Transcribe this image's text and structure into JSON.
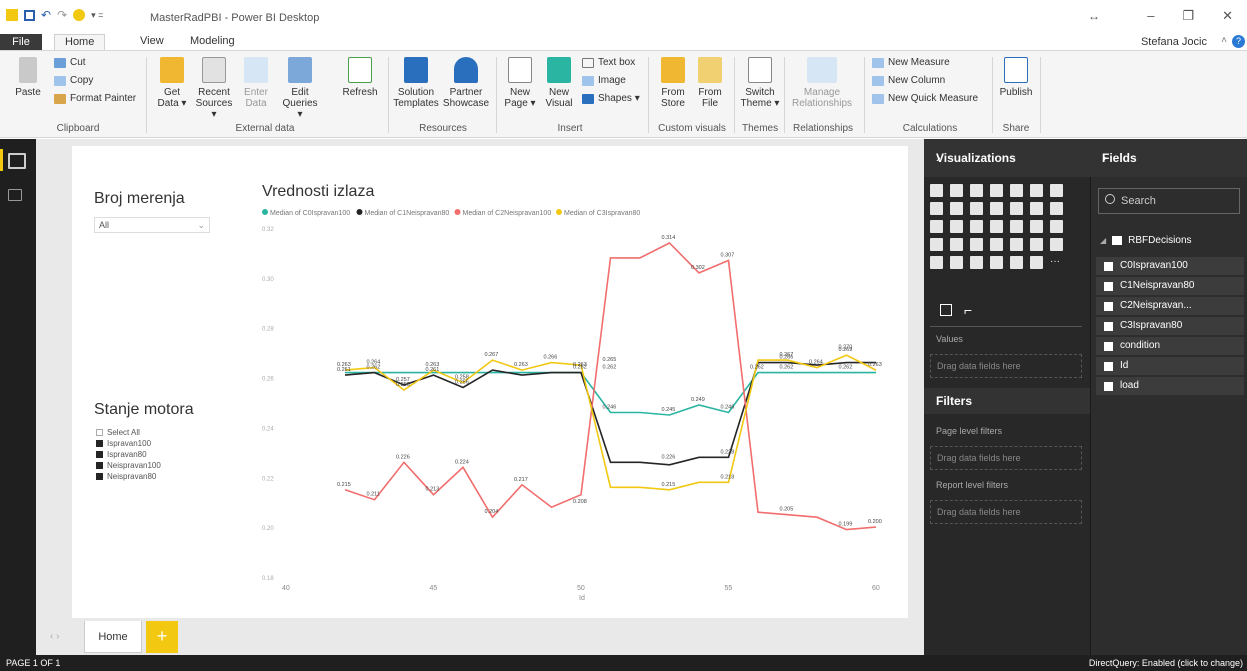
{
  "window": {
    "title": "MasterRadPBI - Power BI Desktop",
    "user": "Stefana Jocic"
  },
  "tabs": {
    "file": "File",
    "home": "Home",
    "view": "View",
    "modeling": "Modeling"
  },
  "ribbon": {
    "paste": "Paste",
    "cut": "Cut",
    "copy": "Copy",
    "format_painter": "Format Painter",
    "get_data": "Get Data ▾",
    "recent_sources": "Recent Sources ▾",
    "enter_data": "Enter Data",
    "edit_queries": "Edit Queries ▾",
    "refresh": "Refresh",
    "solution_templates": "Solution Templates",
    "partner_showcase": "Partner Showcase",
    "new_page": "New Page ▾",
    "new_visual": "New Visual",
    "text_box": "Text box",
    "image": "Image",
    "shapes": "Shapes ▾",
    "from_store": "From Store",
    "from_file": "From File",
    "switch_theme": "Switch Theme ▾",
    "manage_relationships": "Manage Relationships",
    "new_measure": "New Measure",
    "new_column": "New Column",
    "new_quick_measure": "New Quick Measure",
    "publish": "Publish",
    "groups": {
      "clipboard": "Clipboard",
      "external_data": "External data",
      "resources": "Resources",
      "insert": "Insert",
      "custom_visuals": "Custom visuals",
      "themes": "Themes",
      "relationships": "Relationships",
      "calculations": "Calculations",
      "share": "Share"
    }
  },
  "report": {
    "slicer1": {
      "title": "Broj merenja",
      "value": "All"
    },
    "slicer2": {
      "title": "Stanje motora",
      "items": [
        "Select All",
        "Ispravan100",
        "Ispravan80",
        "Neispravan100",
        "Neispravan80"
      ]
    }
  },
  "chart_data": {
    "type": "line",
    "title": "Vrednosti izlaza",
    "xlabel": "Id",
    "ylabel": "",
    "xlim": [
      40,
      60
    ],
    "ylim": [
      0.18,
      0.32
    ],
    "xticks": [
      40,
      45,
      50,
      55,
      60
    ],
    "yticks": [
      "0.18",
      "0.20",
      "0.22",
      "0.24",
      "0.26",
      "0.28",
      "0.30",
      "0.32"
    ],
    "x": [
      42,
      43,
      44,
      45,
      46,
      47,
      48,
      49,
      50,
      51,
      52,
      53,
      54,
      55,
      56,
      57,
      58,
      59,
      60
    ],
    "legend_position": "top-left",
    "series": [
      {
        "name": "Median of C0Ispravan100",
        "color": "#2ab4a2",
        "values": [
          0.262,
          0.262,
          0.262,
          0.262,
          0.262,
          0.262,
          0.262,
          0.262,
          0.262,
          0.246,
          0.246,
          0.245,
          0.249,
          0.246,
          0.262,
          0.262,
          0.262,
          0.262,
          0.262
        ]
      },
      {
        "name": "Median of C1Neispravan80",
        "color": "#252525",
        "values": [
          0.261,
          0.262,
          0.257,
          0.261,
          0.256,
          0.263,
          0.261,
          0.262,
          0.262,
          0.226,
          0.226,
          0.225,
          0.228,
          0.228,
          0.266,
          0.266,
          0.265,
          0.266,
          0.266
        ]
      },
      {
        "name": "Median of C2Neispravan100",
        "color": "#f26d6d",
        "values": [
          0.215,
          0.211,
          0.226,
          0.213,
          0.224,
          0.204,
          0.217,
          0.208,
          0.213,
          0.308,
          0.308,
          0.314,
          0.302,
          0.307,
          0.206,
          0.205,
          0.204,
          0.199,
          0.2
        ]
      },
      {
        "name": "Median of C3Ispravan80",
        "color": "#f2c811",
        "values": [
          0.263,
          0.264,
          0.255,
          0.263,
          0.258,
          0.267,
          0.263,
          0.266,
          0.265,
          0.216,
          0.216,
          0.215,
          0.218,
          0.218,
          0.267,
          0.267,
          0.264,
          0.269,
          0.263
        ]
      }
    ],
    "labels": [
      {
        "x": 42,
        "y": 0.263,
        "t": "0.263"
      },
      {
        "x": 43,
        "y": 0.264,
        "t": "0.264"
      },
      {
        "x": 42,
        "y": 0.261,
        "t": "0.261"
      },
      {
        "x": 43,
        "y": 0.262,
        "t": "0.262"
      },
      {
        "x": 44,
        "y": 0.257,
        "t": "0.257"
      },
      {
        "x": 44,
        "y": 0.255,
        "t": "0.255"
      },
      {
        "x": 45,
        "y": 0.263,
        "t": "0.263"
      },
      {
        "x": 45,
        "y": 0.261,
        "t": "0.261"
      },
      {
        "x": 46,
        "y": 0.258,
        "t": "0.258"
      },
      {
        "x": 46,
        "y": 0.256,
        "t": "0.256"
      },
      {
        "x": 47,
        "y": 0.267,
        "t": "0.267"
      },
      {
        "x": 48,
        "y": 0.263,
        "t": "0.263"
      },
      {
        "x": 49,
        "y": 0.266,
        "t": "0.266"
      },
      {
        "x": 50,
        "y": 0.263,
        "t": "0.263"
      },
      {
        "x": 50,
        "y": 0.262,
        "t": "0.262"
      },
      {
        "x": 51,
        "y": 0.265,
        "t": "0.265"
      },
      {
        "x": 51,
        "y": 0.262,
        "t": "0.262"
      },
      {
        "x": 42,
        "y": 0.215,
        "t": "0.215"
      },
      {
        "x": 43,
        "y": 0.211,
        "t": "0.211"
      },
      {
        "x": 44,
        "y": 0.226,
        "t": "0.226"
      },
      {
        "x": 45,
        "y": 0.213,
        "t": "0.213"
      },
      {
        "x": 46,
        "y": 0.224,
        "t": "0.224"
      },
      {
        "x": 47,
        "y": 0.204,
        "t": "0.204"
      },
      {
        "x": 48,
        "y": 0.217,
        "t": "0.217"
      },
      {
        "x": 50,
        "y": 0.208,
        "t": "0.208"
      },
      {
        "x": 53,
        "y": 0.314,
        "t": "0.314"
      },
      {
        "x": 55,
        "y": 0.307,
        "t": "0.307"
      },
      {
        "x": 54,
        "y": 0.302,
        "t": "0.302"
      },
      {
        "x": 51,
        "y": 0.246,
        "t": "0.246"
      },
      {
        "x": 53,
        "y": 0.245,
        "t": "0.245"
      },
      {
        "x": 54,
        "y": 0.249,
        "t": "0.249"
      },
      {
        "x": 55,
        "y": 0.246,
        "t": "0.246"
      },
      {
        "x": 53,
        "y": 0.226,
        "t": "0.226"
      },
      {
        "x": 55,
        "y": 0.228,
        "t": "0.228"
      },
      {
        "x": 53,
        "y": 0.215,
        "t": "0.215"
      },
      {
        "x": 55,
        "y": 0.218,
        "t": "0.218"
      },
      {
        "x": 56,
        "y": 0.262,
        "t": "0.262"
      },
      {
        "x": 57,
        "y": 0.267,
        "t": "0.267"
      },
      {
        "x": 57,
        "y": 0.266,
        "t": "0.266"
      },
      {
        "x": 57,
        "y": 0.262,
        "t": "0.262"
      },
      {
        "x": 58,
        "y": 0.264,
        "t": "0.264"
      },
      {
        "x": 59,
        "y": 0.269,
        "t": "0.269"
      },
      {
        "x": 59,
        "y": 0.27,
        "t": "0.270"
      },
      {
        "x": 60,
        "y": 0.263,
        "t": "0.263"
      },
      {
        "x": 59,
        "y": 0.262,
        "t": "0.262"
      },
      {
        "x": 57,
        "y": 0.205,
        "t": "0.205"
      },
      {
        "x": 59,
        "y": 0.199,
        "t": "0.199"
      },
      {
        "x": 60,
        "y": 0.2,
        "t": "0.200"
      }
    ]
  },
  "pages": {
    "home_tab": "Home",
    "add": "+"
  },
  "visualizations": {
    "title": "Visualizations",
    "values_label": "Values",
    "drag_here": "Drag data fields here",
    "filters_title": "Filters",
    "page_filters": "Page level filters",
    "report_filters": "Report level filters"
  },
  "fields": {
    "title": "Fields",
    "search_placeholder": "Search",
    "table": "RBFDecisions",
    "items": [
      "C0Ispravan100",
      "C1Neispravan80",
      "C2Neispravan...",
      "C3Ispravan80",
      "condition",
      "Id",
      "load"
    ]
  },
  "status": {
    "page": "PAGE 1 OF 1",
    "directquery": "DirectQuery: Enabled (click to change)"
  },
  "colors": {
    "teal": "#2ab4a2",
    "black": "#252525",
    "red": "#f26d6d",
    "yellow": "#f2c811"
  }
}
